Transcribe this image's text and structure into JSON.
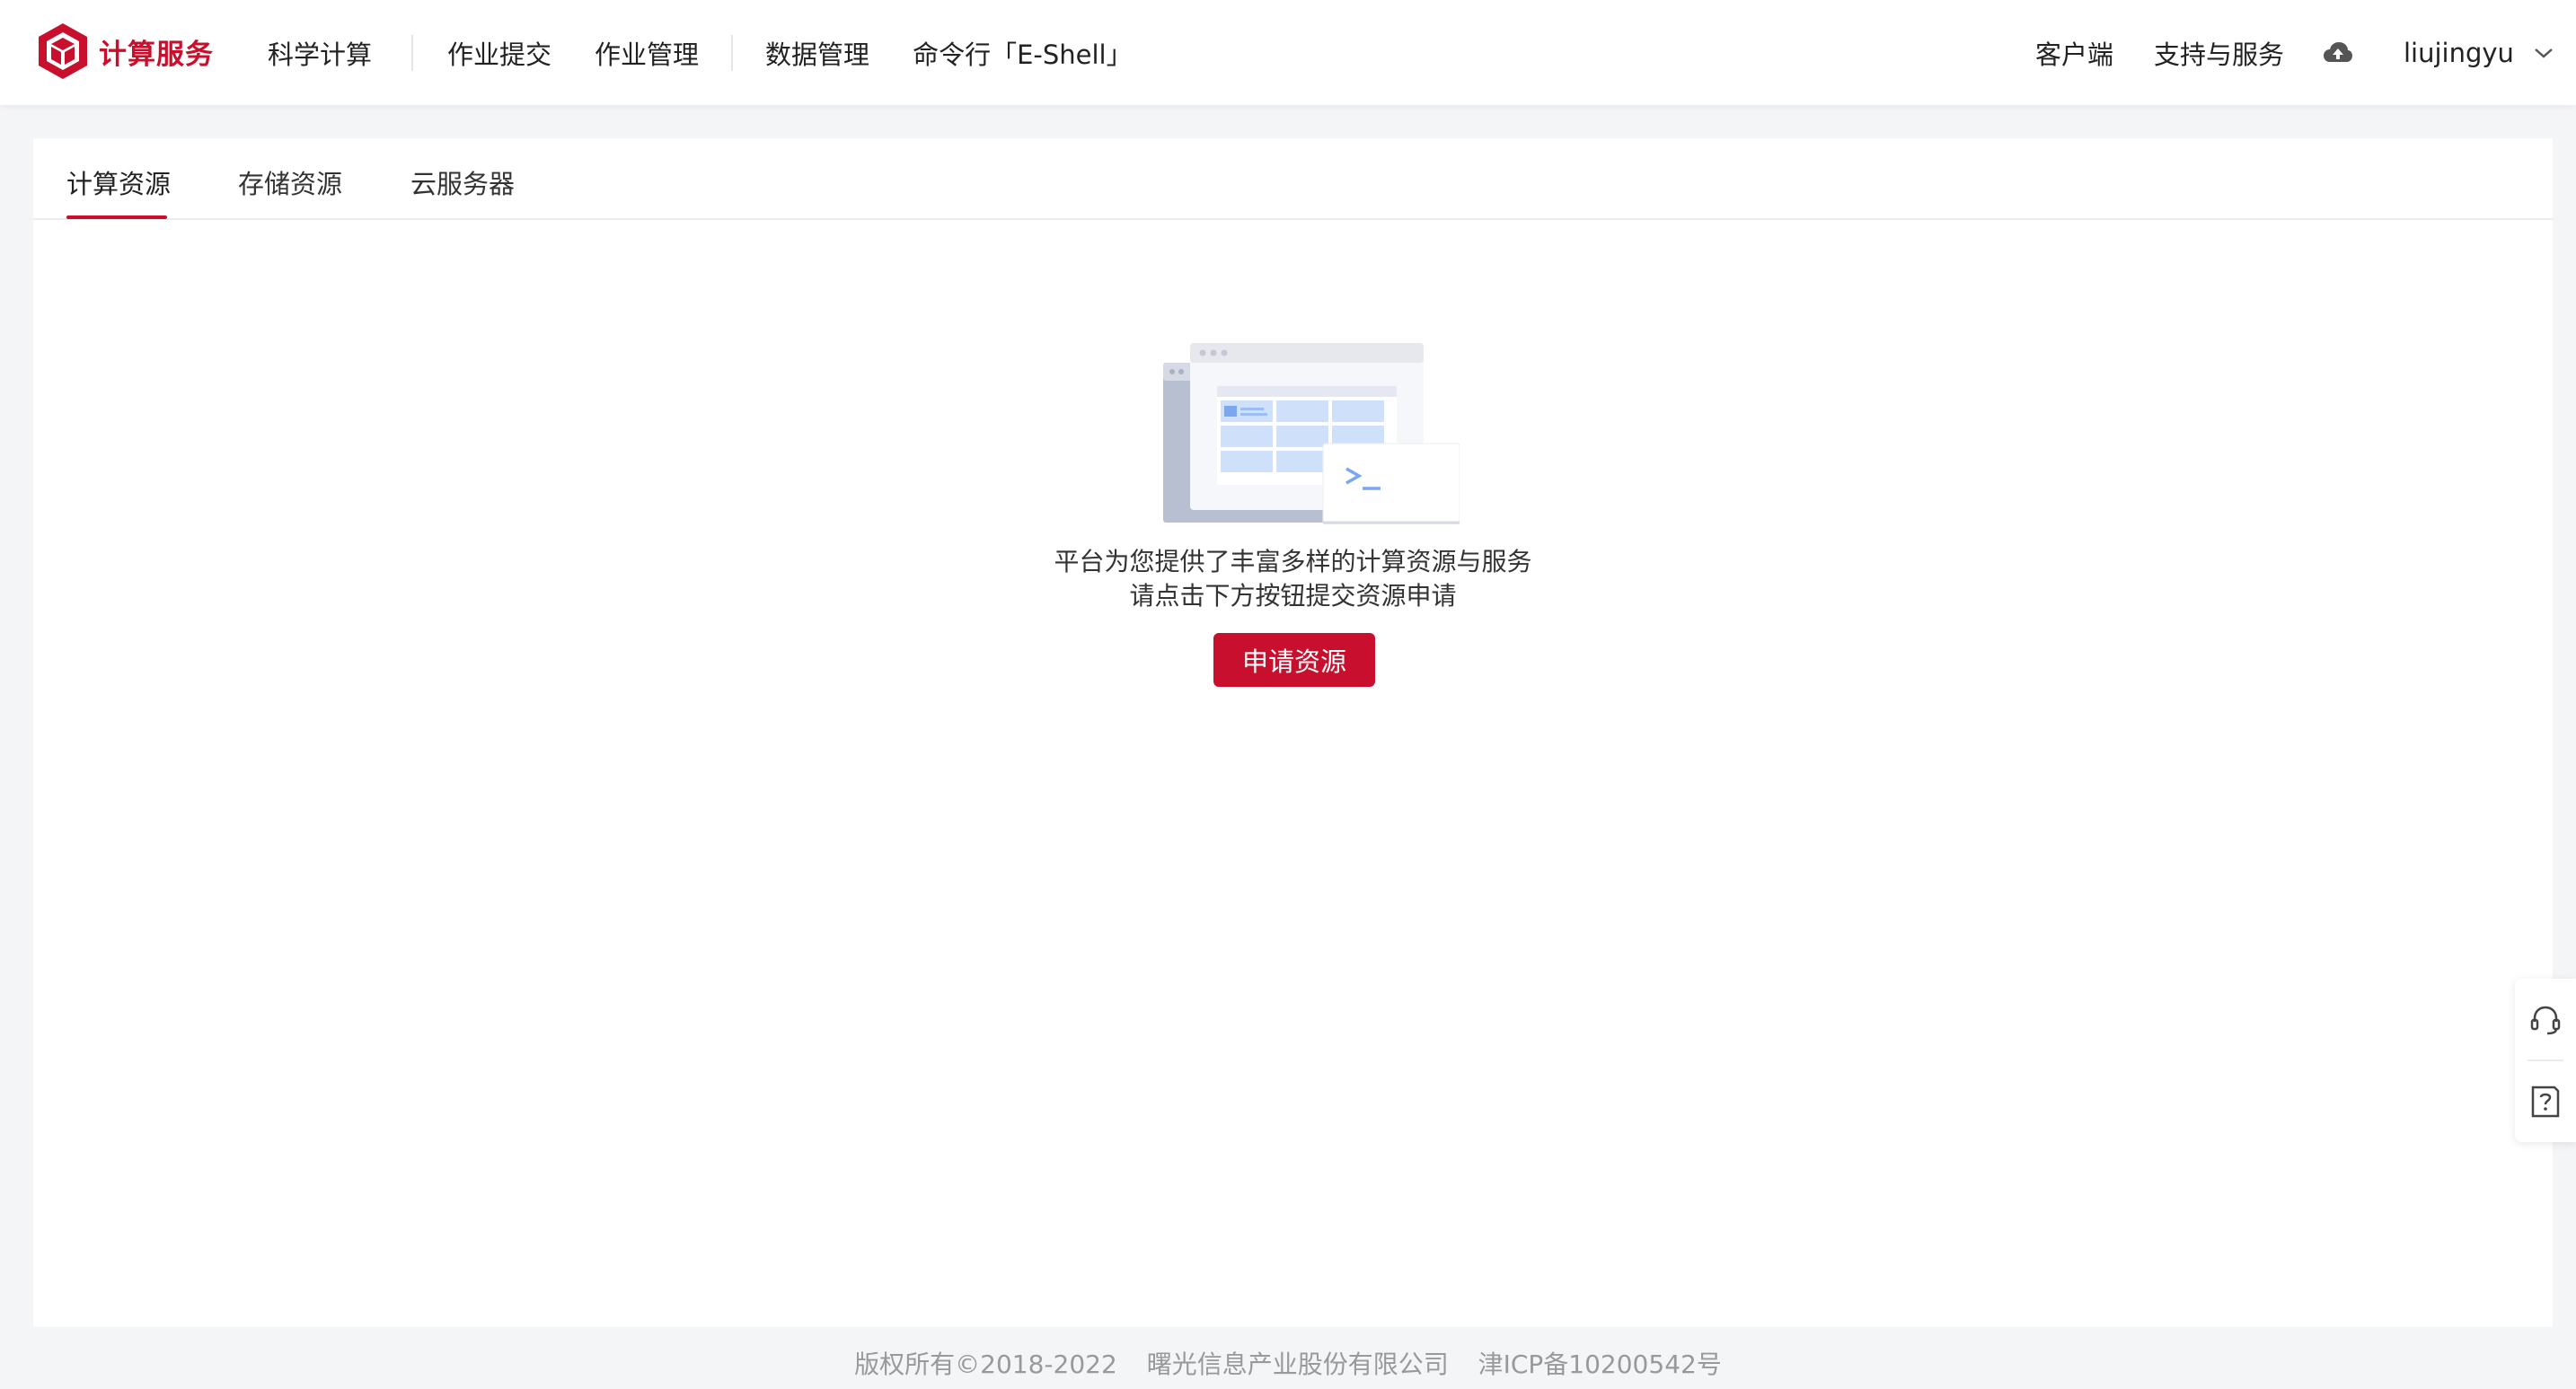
{
  "brand": {
    "name": "计算服务",
    "color": "#c8102e"
  },
  "nav": {
    "items": [
      "科学计算",
      "作业提交",
      "作业管理",
      "数据管理",
      "命令行「E-Shell」"
    ]
  },
  "header_right": {
    "client": "客户端",
    "support": "支持与服务",
    "cloud_icon": "cloud-upload-icon",
    "username": "liujingyu"
  },
  "tabs": [
    {
      "label": "计算资源",
      "active": true
    },
    {
      "label": "存储资源",
      "active": false
    },
    {
      "label": "云服务器",
      "active": false
    }
  ],
  "empty_state": {
    "line1": "平台为您提供了丰富多样的计算资源与服务",
    "line2": "请点击下方按钮提交资源申请",
    "button": "申请资源"
  },
  "float_panel": {
    "icons": [
      "headset-icon",
      "help-document-icon"
    ]
  },
  "footer": {
    "copyright": "版权所有©2018-2022",
    "company": "曙光信息产业股份有限公司",
    "icp": "津ICP备10200542号"
  }
}
